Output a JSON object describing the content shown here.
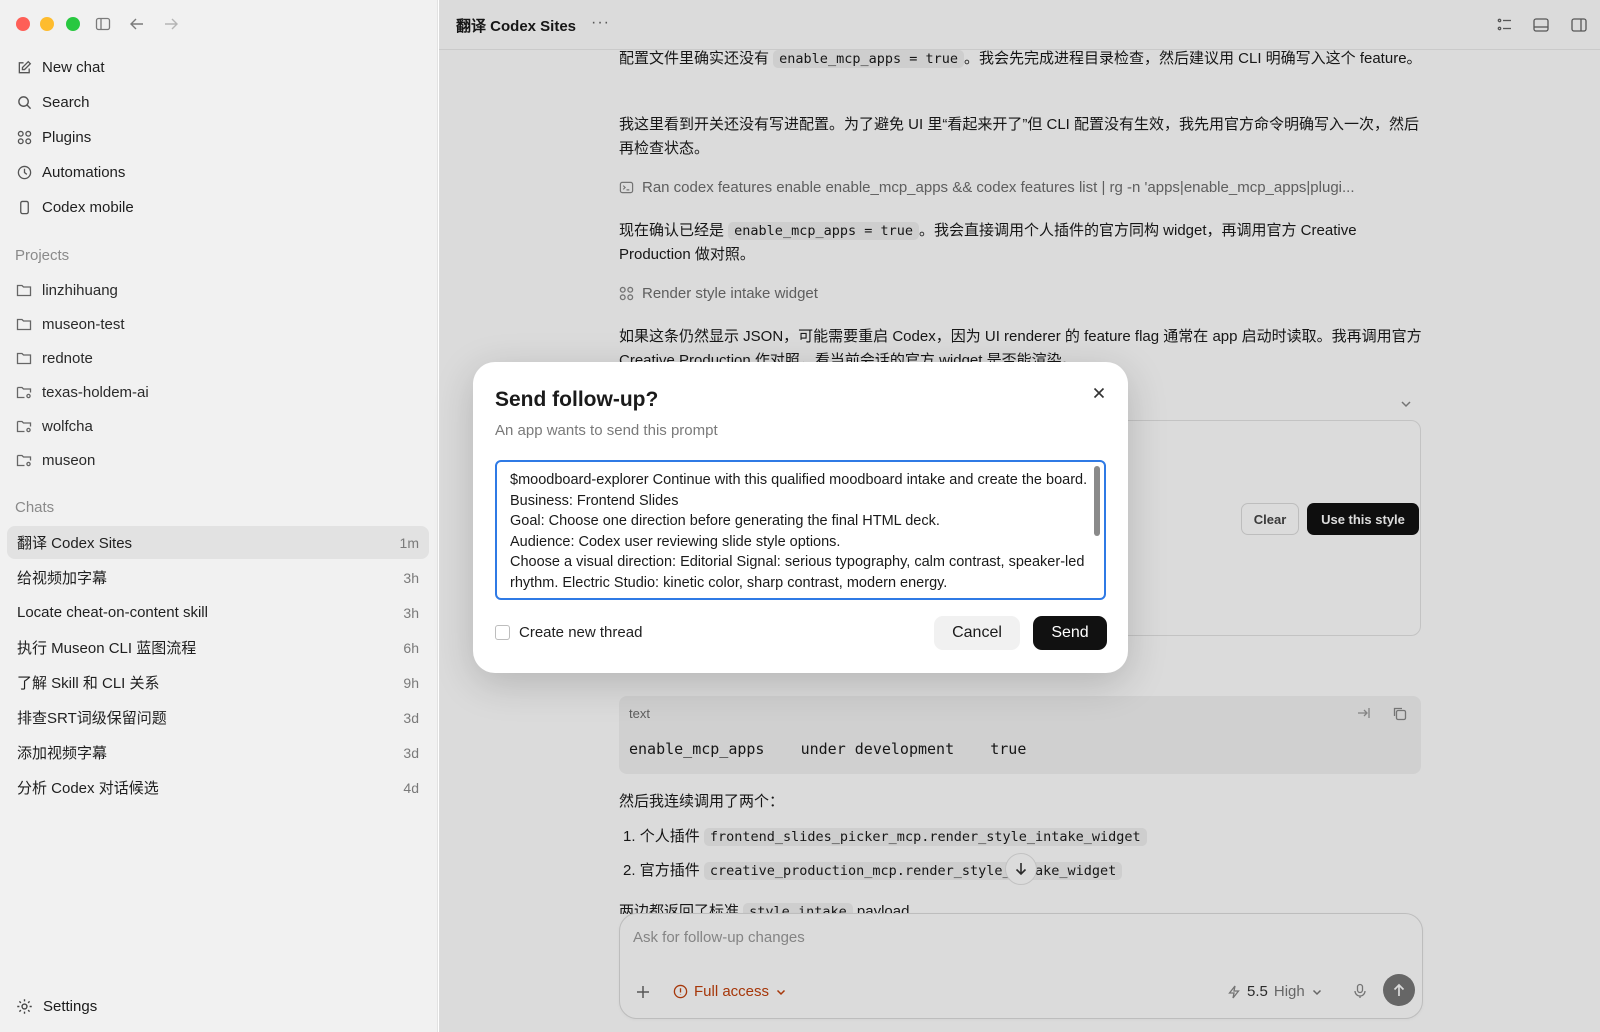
{
  "window": {
    "title": "翻译 Codex Sites"
  },
  "sidebar": {
    "nav": [
      {
        "label": "New chat",
        "icon": "compose-icon"
      },
      {
        "label": "Search",
        "icon": "search-icon"
      },
      {
        "label": "Plugins",
        "icon": "plugins-icon"
      },
      {
        "label": "Automations",
        "icon": "clock-icon"
      },
      {
        "label": "Codex mobile",
        "icon": "phone-icon"
      }
    ],
    "projects_heading": "Projects",
    "projects": [
      "linzhihuang",
      "museon-test",
      "rednote",
      "texas-holdem-ai",
      "wolfcha",
      "museon"
    ],
    "chats_heading": "Chats",
    "chats": [
      {
        "title": "翻译 Codex Sites",
        "time": "1m"
      },
      {
        "title": "给视频加字幕",
        "time": "3h"
      },
      {
        "title": "Locate cheat-on-content skill",
        "time": "3h"
      },
      {
        "title": "执行 Museon CLI 蓝图流程",
        "time": "6h"
      },
      {
        "title": "了解 Skill 和 CLI 关系",
        "time": "9h"
      },
      {
        "title": "排查SRT词级保留问题",
        "time": "3d"
      },
      {
        "title": "添加视频字幕",
        "time": "3d"
      },
      {
        "title": "分析 Codex 对话候选",
        "time": "4d"
      }
    ],
    "settings_label": "Settings"
  },
  "main": {
    "topbar": {
      "title": "翻译 Codex Sites",
      "more": "···"
    },
    "messages": {
      "p1_a": "配置文件里确实还没有 ",
      "p1_code": "enable_mcp_apps = true",
      "p1_b": "。我会先完成进程目录检查，然后建议用 CLI 明确写入这个 feature。",
      "p2": "我这里看到开关还没有写进配置。为了避免 UI 里“看起来开了”但 CLI 配置没有生效，我先用官方命令明确写入一次，然后再检查状态。",
      "tool1": "Ran codex features enable enable_mcp_apps && codex features list | rg -n 'apps|enable_mcp_apps|plugi...",
      "p3_a": "现在确认已经是 ",
      "p3_code": "enable_mcp_apps = true",
      "p3_b": "。我会直接调用个人插件的官方同构 widget，再调用官方 Creative Production 做对照。",
      "tool2": "Render style intake widget",
      "p4": "如果这条仍然显示 JSON，可能需要重启 Codex，因为 UI renderer 的 feature flag 通常在 app 启动时读取。我再调用官方 Creative Production 作对照，看当前会话的官方 widget 是否能渲染。",
      "widget_clear": "Clear",
      "widget_use": "Use this style",
      "code_lang": "text",
      "code_line": "enable_mcp_apps    under development    true",
      "p5": "然后我连续调用了两个：",
      "li1_label": "个人插件",
      "li1_code": "frontend_slides_picker_mcp.render_style_intake_widget",
      "li2_label": "官方插件",
      "li2_code": "creative_production_mcp.render_style_intake_widget",
      "p6_a": "两边都返回了标准 ",
      "p6_code": "style_intake",
      "p6_b": " payload"
    },
    "composer": {
      "placeholder": "Ask for follow-up changes",
      "access": "Full access",
      "model": "5.5",
      "effort": "High"
    }
  },
  "dialog": {
    "title": "Send follow-up?",
    "subtitle": "An app wants to send this prompt",
    "prompt": "$moodboard-explorer Continue with this qualified moodboard intake and create the board.\nBusiness: Frontend Slides\nGoal: Choose one direction before generating the final HTML deck.\nAudience: Codex user reviewing slide style options.\nChoose a visual direction: Editorial Signal: serious typography, calm contrast, speaker-led rhythm. Electric Studio: kinetic color, sharp contrast, modern energy.",
    "checkbox_label": "Create new thread",
    "checkbox_checked": false,
    "cancel": "Cancel",
    "send": "Send"
  },
  "colors": {
    "accent_blue": "#2f7ae5",
    "warning_orange": "#c2410c",
    "send_black": "#111111"
  }
}
